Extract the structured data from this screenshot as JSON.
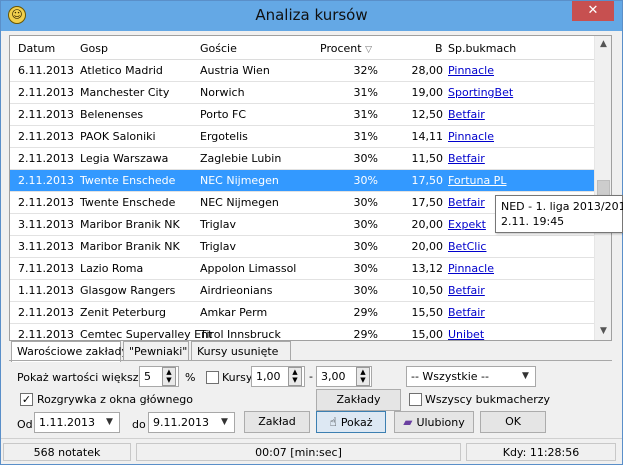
{
  "window": {
    "title": "Analiza kursów",
    "close_glyph": "✕",
    "app_icon": "app-logo-icon"
  },
  "table": {
    "headers": {
      "date": "Datum",
      "home": "Gosp",
      "away": "Goście",
      "percent": "Procent",
      "b": "B",
      "bookmaker": "Sp.bukmach"
    },
    "sort_indicator": "▽",
    "rows": [
      {
        "date": "6.11.2013",
        "home": "Atletico Madrid",
        "away": "Austria Wien",
        "percent": "32%",
        "odds": "28,00",
        "bookmaker": "Pinnacle"
      },
      {
        "date": "2.11.2013",
        "home": "Manchester City",
        "away": "Norwich",
        "percent": "31%",
        "odds": "19,00",
        "bookmaker": "SportingBet"
      },
      {
        "date": "2.11.2013",
        "home": "Belenenses",
        "away": "Porto FC",
        "percent": "31%",
        "odds": "12,50",
        "bookmaker": "Betfair"
      },
      {
        "date": "2.11.2013",
        "home": "PAOK Saloniki",
        "away": "Ergotelis",
        "percent": "31%",
        "odds": "14,11",
        "bookmaker": "Pinnacle"
      },
      {
        "date": "2.11.2013",
        "home": "Legia Warszawa",
        "away": "Zaglebie Lubin",
        "percent": "30%",
        "odds": "11,50",
        "bookmaker": "Betfair"
      },
      {
        "date": "2.11.2013",
        "home": "Twente Enschede",
        "away": "NEC Nijmegen",
        "percent": "30%",
        "odds": "17,50",
        "bookmaker": "Fortuna PL",
        "selected": true
      },
      {
        "date": "2.11.2013",
        "home": "Twente Enschede",
        "away": "NEC Nijmegen",
        "percent": "30%",
        "odds": "17,50",
        "bookmaker": "Betfair"
      },
      {
        "date": "3.11.2013",
        "home": "Maribor Branik NK",
        "away": "Triglav",
        "percent": "30%",
        "odds": "20,00",
        "bookmaker": "Expekt"
      },
      {
        "date": "3.11.2013",
        "home": "Maribor Branik NK",
        "away": "Triglav",
        "percent": "30%",
        "odds": "20,00",
        "bookmaker": "BetClic"
      },
      {
        "date": "7.11.2013",
        "home": "Lazio Roma",
        "away": "Appolon Limassol",
        "percent": "30%",
        "odds": "13,12",
        "bookmaker": "Pinnacle"
      },
      {
        "date": "1.11.2013",
        "home": "Glasgow Rangers",
        "away": "Airdrieonians",
        "percent": "30%",
        "odds": "10,50",
        "bookmaker": "Betfair"
      },
      {
        "date": "2.11.2013",
        "home": "Zenit Peterburg",
        "away": "Amkar Perm",
        "percent": "29%",
        "odds": "15,50",
        "bookmaker": "Betfair"
      },
      {
        "date": "2.11.2013",
        "home": "Cemtec Supervalley Ent",
        "away": "Tirol Innsbruck",
        "percent": "29%",
        "odds": "15,00",
        "bookmaker": "Unibet"
      }
    ]
  },
  "tooltip": {
    "line1": "NED - 1. liga 2013/2014",
    "line2": "2.11. 19:45"
  },
  "tabs": [
    "Warościowe zakłady",
    "\"Pewniaki\"",
    "Kursy usunięte"
  ],
  "filters": {
    "show_label": "Pokaż wartości większe niż",
    "threshold_value": "5",
    "percent_sign": "%",
    "kursy_label": "Kursy",
    "kursy_from": "1,00",
    "dash": "-",
    "kursy_to": "3,00",
    "league_combo": "-- Wszystkie --",
    "main_window_label": "Rozgrywka z okna głównego",
    "main_window_checked": true,
    "all_bookmakers_label": "Wszyscy bukmacherzy",
    "all_bookmakers_checked": false,
    "from_label": "Od",
    "date_from": "1.11.2013",
    "to_label": "do",
    "date_to": "9.11.2013"
  },
  "buttons": {
    "zaklad": "Zakład",
    "zaklady": "Zakłady",
    "pokaz": "Pokaż",
    "ulubiony": "Ulubiony",
    "ok": "OK"
  },
  "status": {
    "notes": "568 notatek",
    "timer": "00:07  [min:sec]",
    "time": "Kdy: 11:28:56"
  }
}
